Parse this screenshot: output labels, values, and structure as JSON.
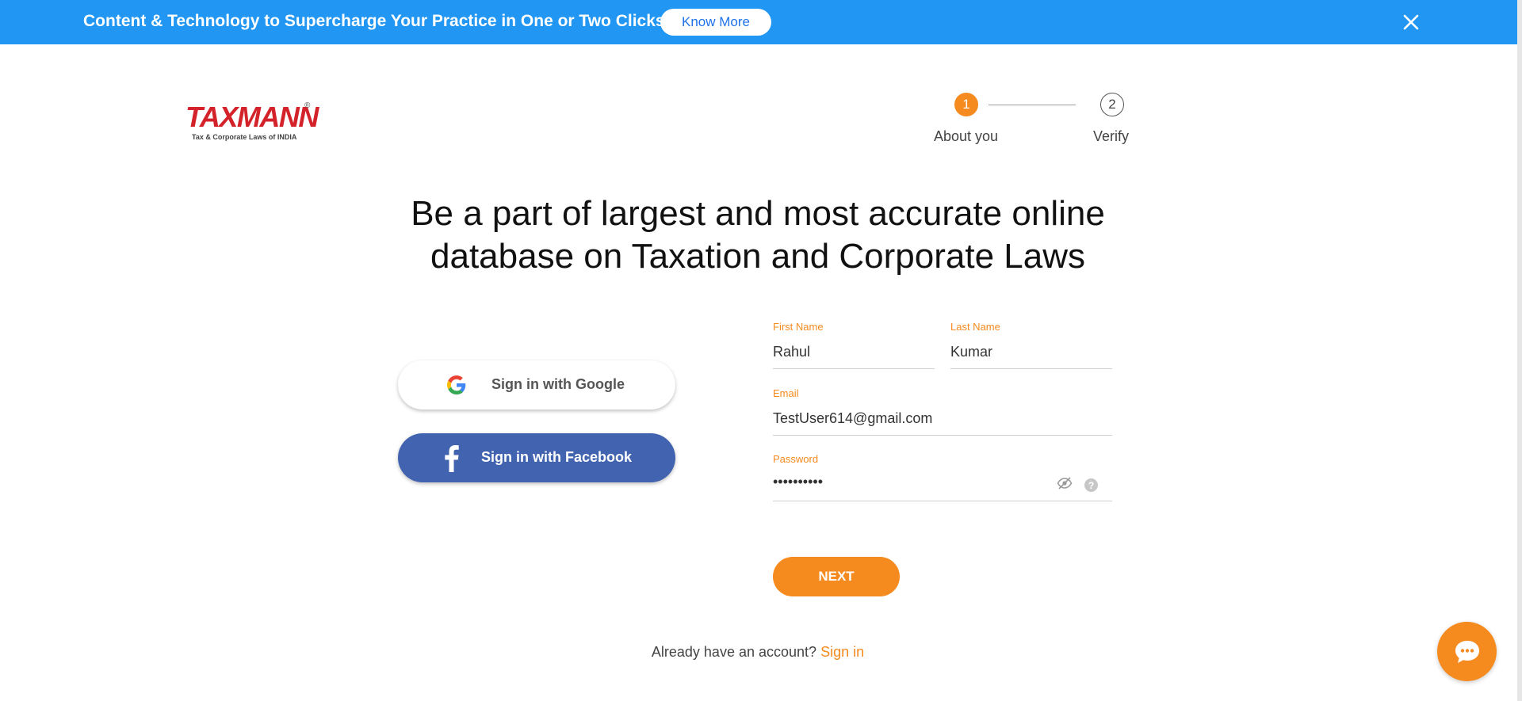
{
  "banner": {
    "text": "Content & Technology to Supercharge Your Practice in One or Two Clicks.",
    "know_more_label": "Know More",
    "background_color": "#2196f3"
  },
  "logo": {
    "word": "TAXMANN",
    "registered": "®",
    "tagline": "Tax & Corporate Laws of INDIA"
  },
  "stepper": {
    "steps": [
      {
        "number": "1",
        "label": "About you",
        "active": true
      },
      {
        "number": "2",
        "label": "Verify",
        "active": false
      }
    ],
    "accent_color": "#f58a1f"
  },
  "headline": {
    "line1": "Be a part of largest and most accurate online",
    "line2": "database on Taxation and Corporate Laws"
  },
  "social": {
    "google_label": "Sign in with Google",
    "facebook_label": "Sign in with Facebook",
    "facebook_color": "#4264b0"
  },
  "form": {
    "first_name": {
      "label": "First Name",
      "value": "Rahul"
    },
    "last_name": {
      "label": "Last Name",
      "value": "Kumar"
    },
    "email": {
      "label": "Email",
      "value": "TestUser614@gmail.com"
    },
    "password": {
      "label": "Password",
      "masked_value": "••••••••••",
      "help_glyph": "?"
    }
  },
  "next_label": "NEXT",
  "footer": {
    "prompt": "Already have an account?",
    "signin_label": "Sign in"
  },
  "icons": {
    "banner_close": "close-icon",
    "google": "google-icon",
    "facebook": "facebook-icon",
    "password_visibility": "eye-off-icon",
    "password_help": "help-icon",
    "chat": "chat-icon"
  }
}
